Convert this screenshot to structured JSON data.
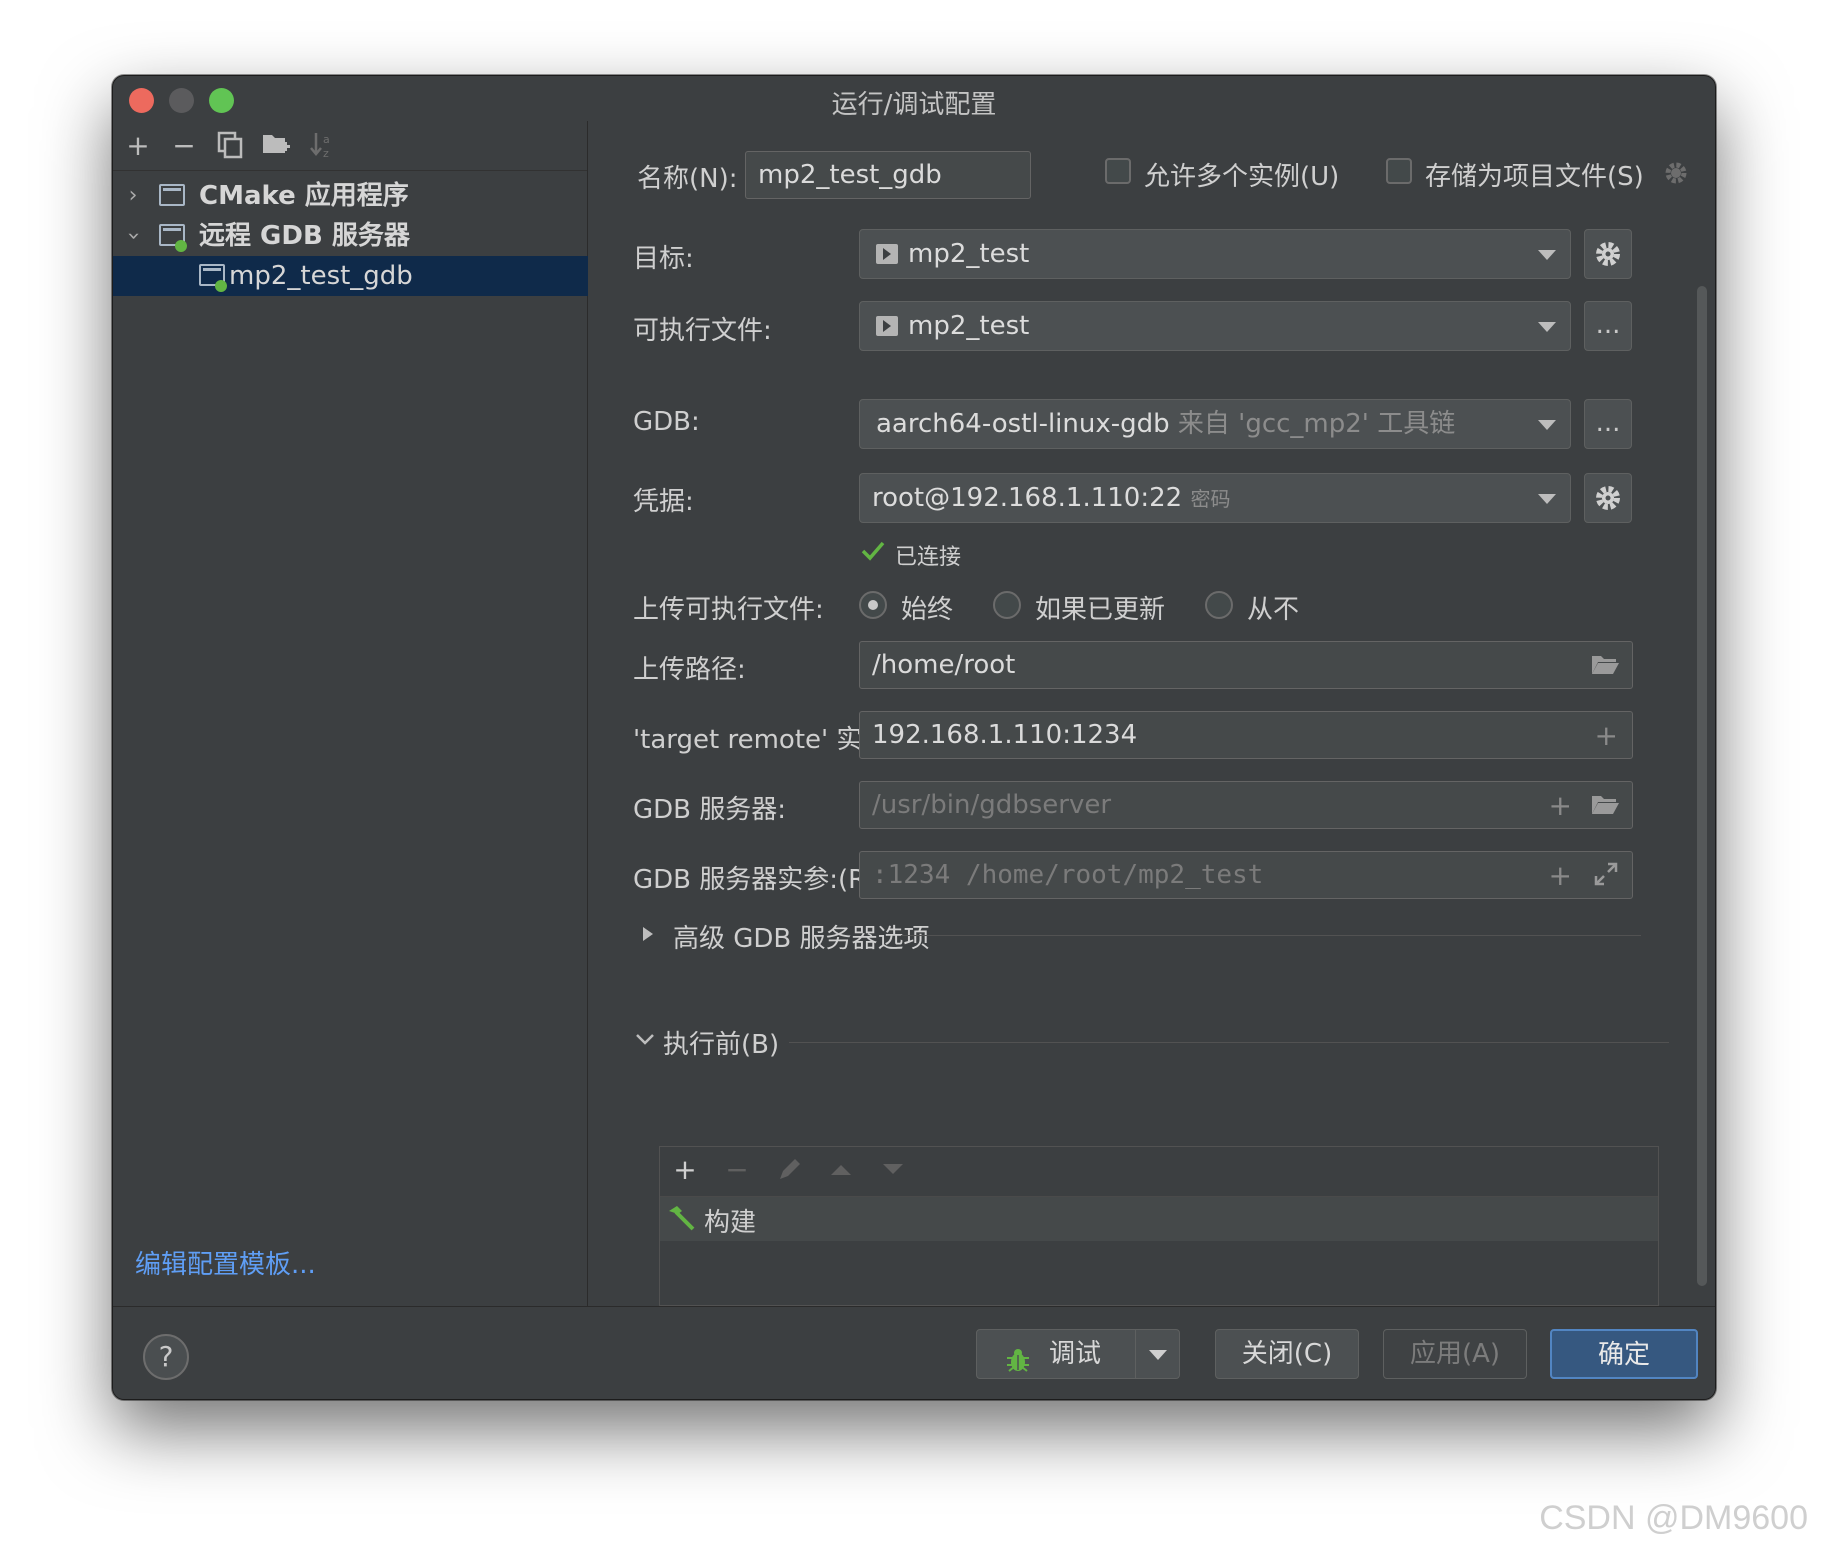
{
  "window": {
    "title": "运行/调试配置"
  },
  "left": {
    "tree": [
      {
        "label": "CMake 应用程序",
        "expanded": false
      },
      {
        "label": "远程 GDB 服务器",
        "expanded": true
      },
      {
        "label": "mp2_test_gdb",
        "selected": true
      }
    ],
    "edit_templates": "编辑配置模板..."
  },
  "form": {
    "name_label": "名称(N):",
    "name_value": "mp2_test_gdb",
    "allow_multi": "允许多个实例(U)",
    "store_as_file": "存储为项目文件(S)",
    "target_label": "目标:",
    "target_value": "mp2_test",
    "exe_label": "可执行文件:",
    "exe_value": "mp2_test",
    "gdb_label": "GDB:",
    "gdb_value": "aarch64-ostl-linux-gdb",
    "gdb_hint": "来自 'gcc_mp2' 工具链",
    "cred_label": "凭据:",
    "cred_value": "root@192.168.1.110:22",
    "cred_hint": "密码",
    "connected": "已连接",
    "upload_label": "上传可执行文件:",
    "upload_opts": [
      "始终",
      "如果已更新",
      "从不"
    ],
    "upload_path_label": "上传路径:",
    "upload_path": "/home/root",
    "target_remote_label": "'target remote' 实...",
    "target_remote": "192.168.1.110:1234",
    "gdb_server_label": "GDB 服务器:",
    "gdb_server": "/usr/bin/gdbserver",
    "gdb_server_args_label": "GDB 服务器实参:(R)",
    "gdb_server_args": ":1234 /home/root/mp2_test",
    "advanced": "高级 GDB 服务器选项",
    "before_launch": "执行前(B)",
    "before_items": [
      "构建"
    ],
    "more_btn": "...",
    "accent_green": "#62b543"
  },
  "buttons": {
    "help": "?",
    "debug": "调试",
    "close": "关闭(C)",
    "apply": "应用(A)",
    "ok": "确定"
  },
  "watermark": "CSDN @DM9600"
}
